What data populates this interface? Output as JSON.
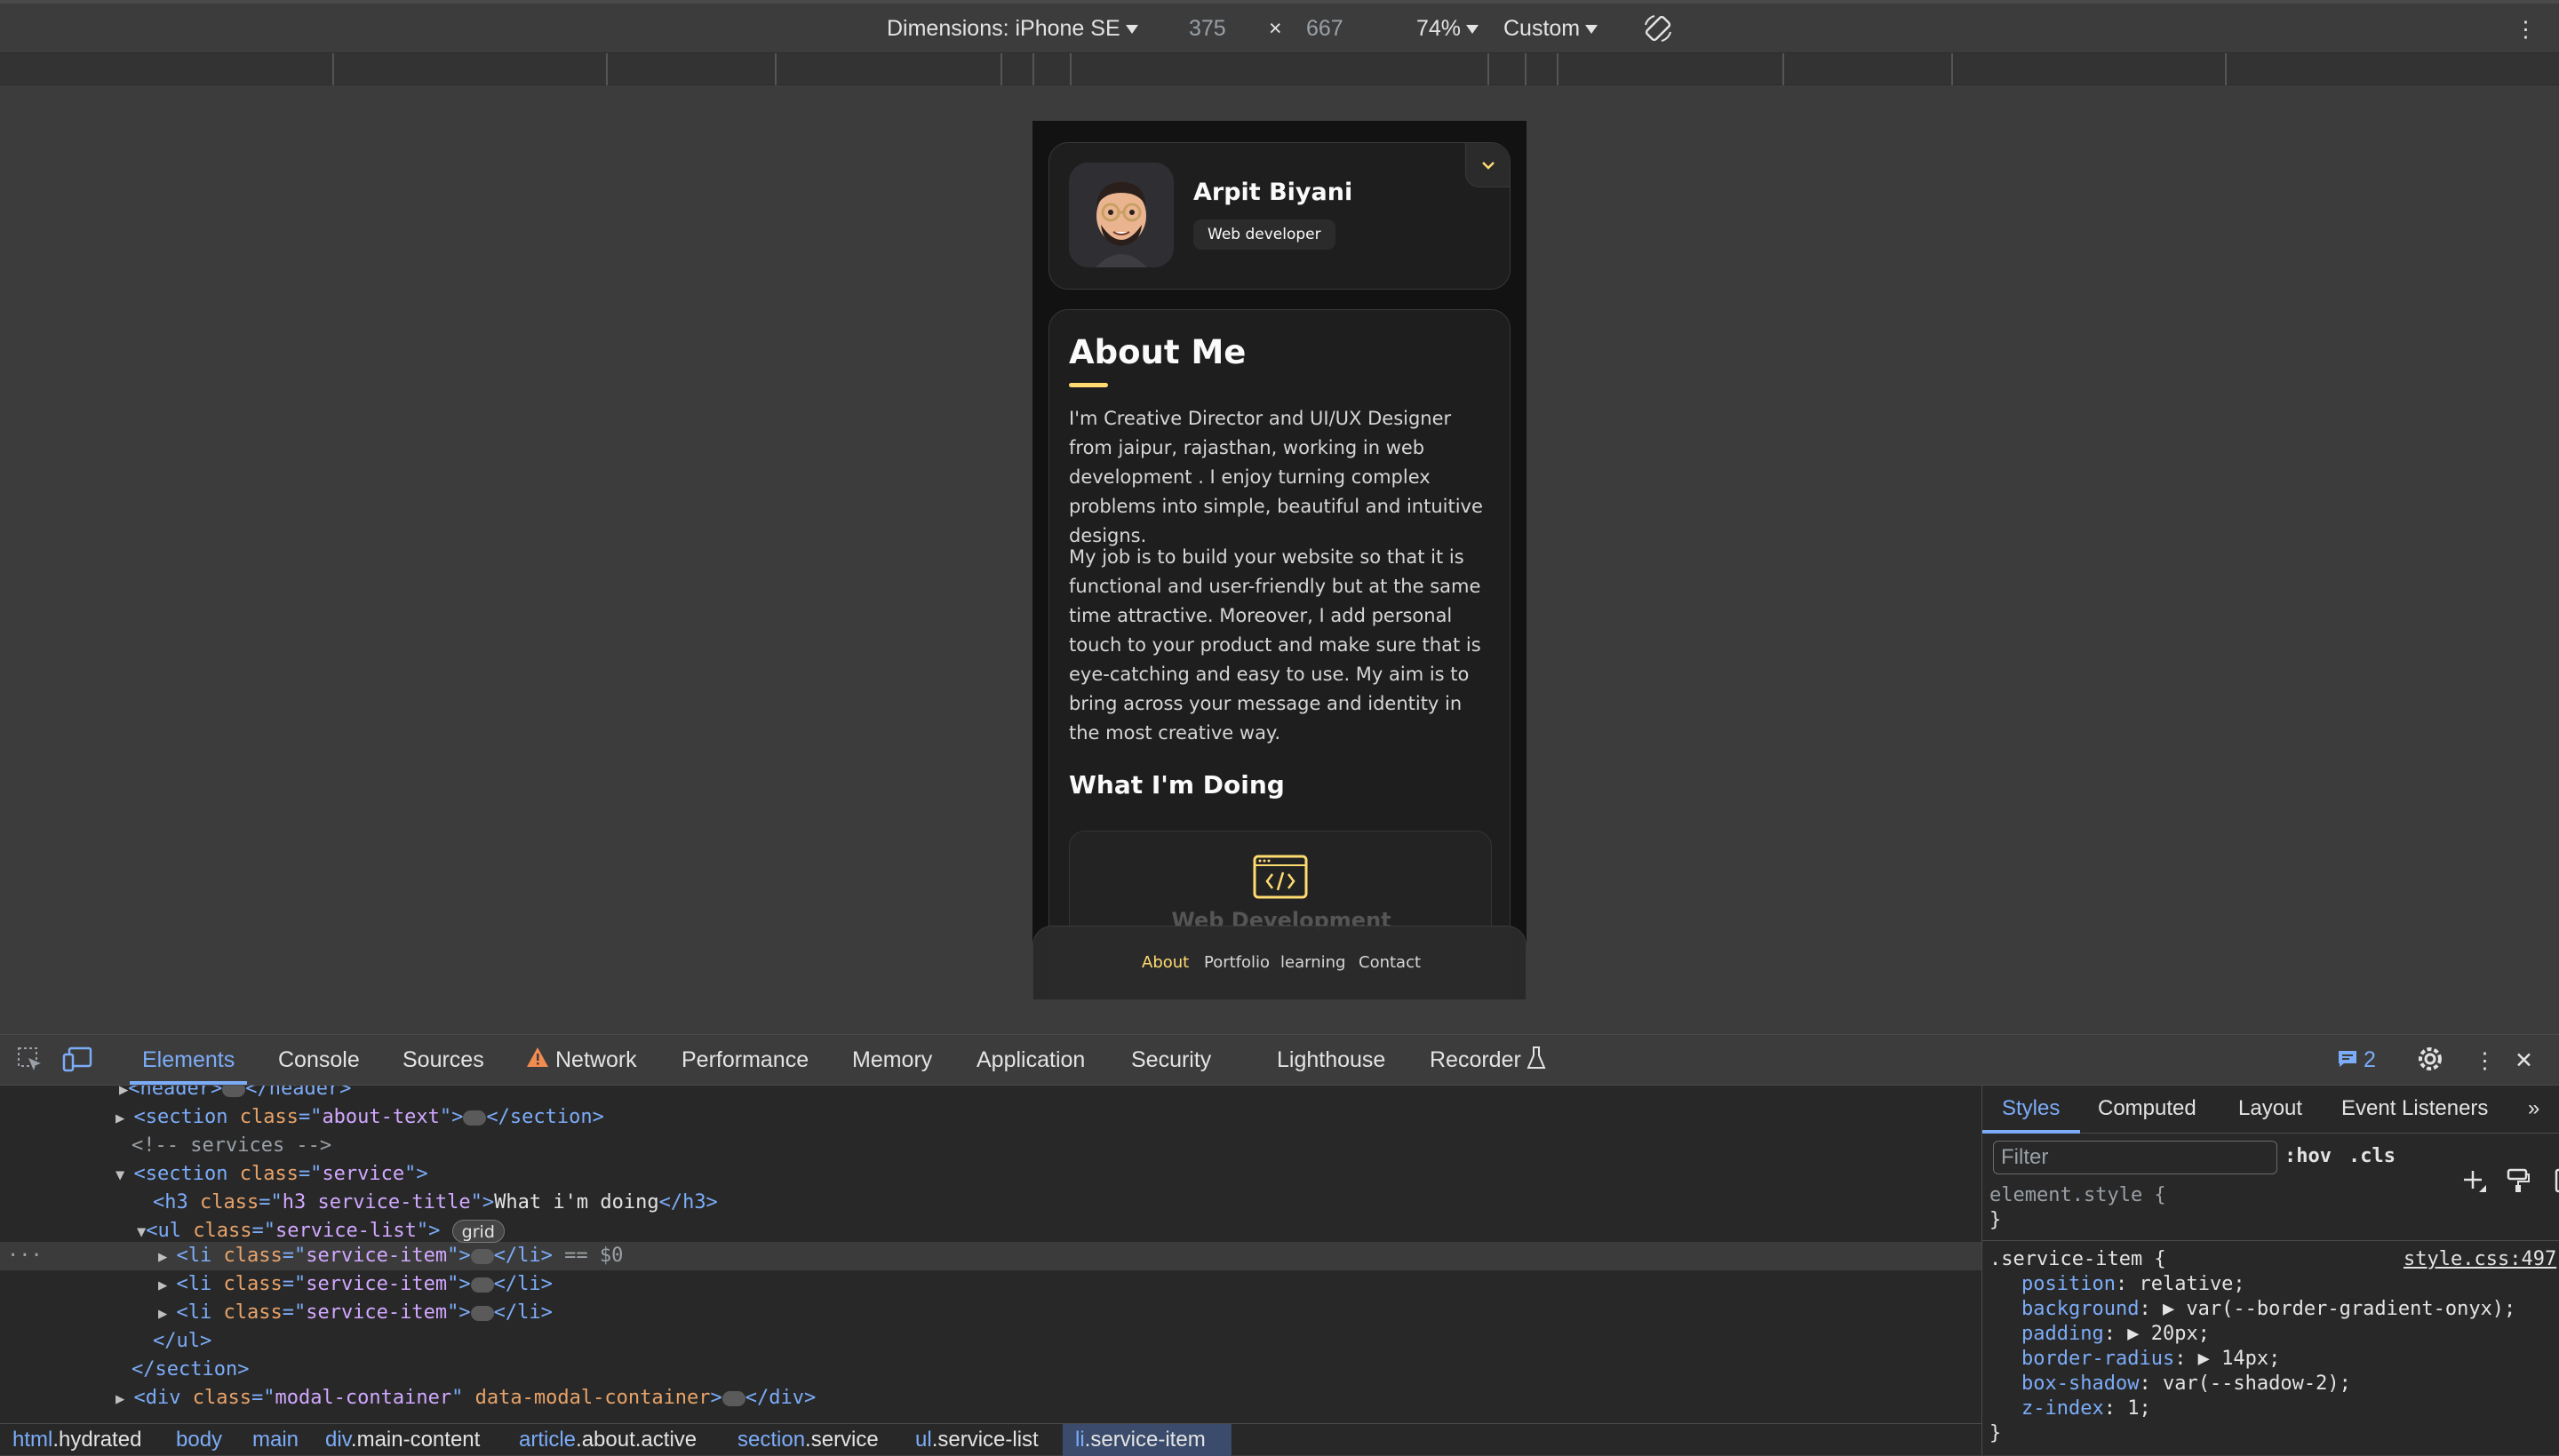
{
  "device_toolbar": {
    "dimensions_label": "Dimensions: iPhone SE",
    "width": "375",
    "times": "×",
    "height": "667",
    "zoom": "74%",
    "throttle": "Custom",
    "more": "⋮"
  },
  "page": {
    "profile": {
      "name": "Arpit Biyani",
      "role": "Web developer"
    },
    "about": {
      "title": "About Me",
      "paragraph1": "I'm Creative Director and UI/UX Designer from jaipur, rajasthan, working in web development . I enjoy turning complex problems into simple, beautiful and intuitive designs.",
      "paragraph2": "My job is to build your website so that it is functional and user-friendly but at the same time attractive. Moreover, I add personal touch to your product and make sure that is eye-catching and easy to use. My aim is to bring across your message and identity in the most creative way.",
      "doing_title": "What I'm Doing",
      "service_name": "Web Development"
    },
    "navbar": {
      "items": [
        "About",
        "Portfolio",
        "learning",
        "Contact"
      ],
      "active": "About"
    }
  },
  "devtools": {
    "tabs": [
      "Elements",
      "Console",
      "Sources",
      "Network",
      "Performance",
      "Memory",
      "Application",
      "Security",
      "Lighthouse",
      "Recorder"
    ],
    "active_tab": "Elements",
    "issues_count": "2",
    "dom": {
      "header_tag": "<header>",
      "header_close": "</header>",
      "section_about_class": "about-text",
      "comment_services": "<!-- services -->",
      "section_service_class": "service",
      "h3_class": "h3 service-title",
      "h3_text": "What i'm doing",
      "ul_class": "service-list",
      "grid_badge": "grid",
      "li_class": "service-item",
      "selected_marker": "== $0",
      "modal_class": "modal-container",
      "modal_attr": "data-modal-container"
    },
    "breadcrumb": [
      {
        "tag": "html",
        "cls": ".hydrated"
      },
      {
        "tag": "body",
        "cls": ""
      },
      {
        "tag": "main",
        "cls": ""
      },
      {
        "tag": "div",
        "cls": ".main-content"
      },
      {
        "tag": "article",
        "cls": ".about.active"
      },
      {
        "tag": "section",
        "cls": ".service"
      },
      {
        "tag": "ul",
        "cls": ".service-list"
      },
      {
        "tag": "li",
        "cls": ".service-item"
      }
    ],
    "styles": {
      "tabs": [
        "Styles",
        "Computed",
        "Layout",
        "Event Listeners"
      ],
      "filter_placeholder": "Filter",
      "hov": ":hov",
      "cls": ".cls",
      "element_style": "element.style {",
      "close_brace": "}",
      "rule_selector": ".service-item {",
      "rule_source": "style.css:497",
      "declarations": [
        {
          "prop": "position",
          "value": "relative;"
        },
        {
          "prop": "background",
          "value": "var(--border-gradient-onyx);"
        },
        {
          "prop": "padding",
          "value": "20px;"
        },
        {
          "prop": "border-radius",
          "value": "14px;"
        },
        {
          "prop": "box-shadow",
          "value": "var(--shadow-2);"
        },
        {
          "prop": "z-index",
          "value": "1;"
        }
      ]
    }
  }
}
